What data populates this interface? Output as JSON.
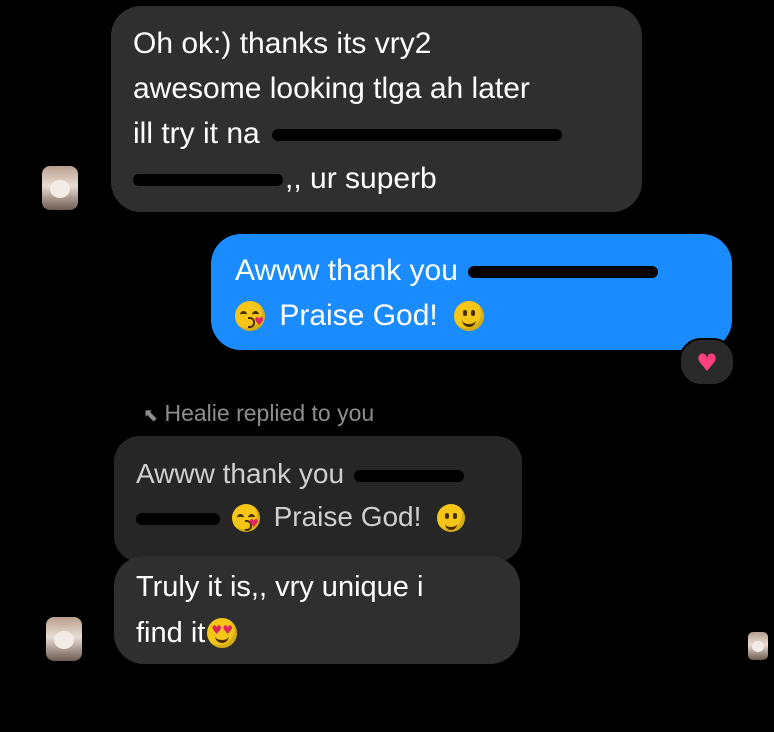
{
  "messages": {
    "m1": {
      "line1": "Oh ok:) thanks its vry2",
      "line2": "awesome looking tlga ah later",
      "line3": "ill try it na",
      "line4": ",, ur superb"
    },
    "m2": {
      "line1": "Awww thank you",
      "line2": "Praise God!",
      "reaction": "heart"
    },
    "reply": {
      "label": "Healie replied to you",
      "quoted_line1": "Awww thank you",
      "quoted_line2": "Praise God!"
    },
    "m3": {
      "line1": "Truly it is,, vry unique i",
      "line2": "find it"
    }
  },
  "colors": {
    "background": "#000000",
    "incoming_bubble": "#2f2f2f",
    "outgoing_bubble": "#1a8cff",
    "reaction_heart": "#ff3f7f"
  },
  "icons": {
    "reply": "reply-arrow-icon",
    "reaction": "heart-icon"
  }
}
